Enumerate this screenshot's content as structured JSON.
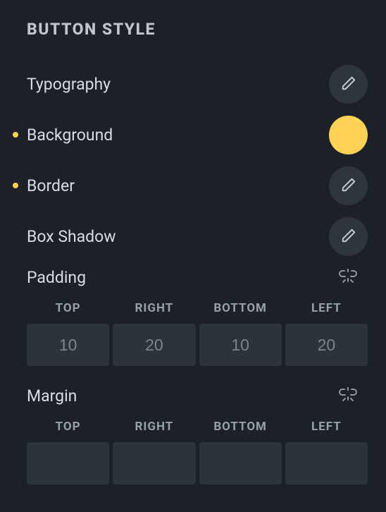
{
  "section": {
    "title": "BUTTON STYLE"
  },
  "controls": {
    "typography": {
      "label": "Typography",
      "modified": false
    },
    "background": {
      "label": "Background",
      "modified": true,
      "color": "#ffd255"
    },
    "border": {
      "label": "Border",
      "modified": true
    },
    "boxShadow": {
      "label": "Box Shadow",
      "modified": false
    }
  },
  "padding": {
    "label": "Padding",
    "headers": {
      "top": "TOP",
      "right": "RIGHT",
      "bottom": "BOTTOM",
      "left": "LEFT"
    },
    "values": {
      "top": "10",
      "right": "20",
      "bottom": "10",
      "left": "20"
    }
  },
  "margin": {
    "label": "Margin",
    "headers": {
      "top": "TOP",
      "right": "RIGHT",
      "bottom": "BOTTOM",
      "left": "LEFT"
    },
    "values": {
      "top": "",
      "right": "",
      "bottom": "",
      "left": ""
    }
  }
}
